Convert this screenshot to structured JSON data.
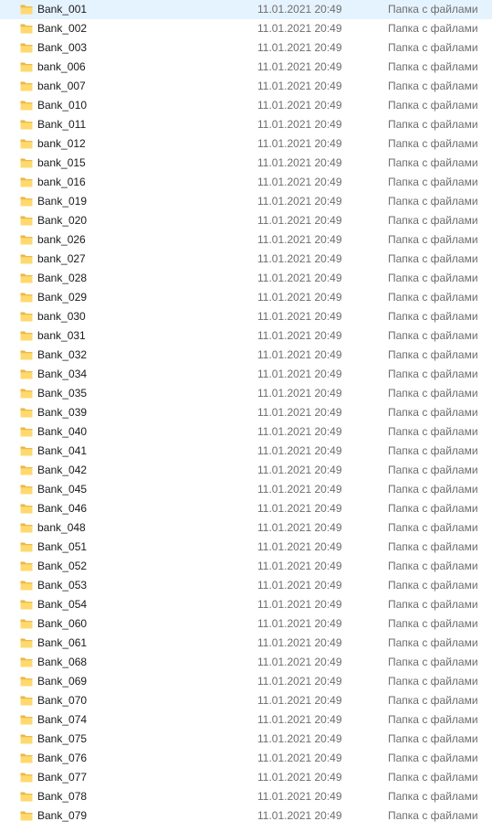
{
  "file_list": {
    "icon": "folder-icon",
    "items": [
      {
        "name": "Bank_001",
        "date": "11.01.2021 20:49",
        "type": "Папка с файлами"
      },
      {
        "name": "Bank_002",
        "date": "11.01.2021 20:49",
        "type": "Папка с файлами"
      },
      {
        "name": "Bank_003",
        "date": "11.01.2021 20:49",
        "type": "Папка с файлами"
      },
      {
        "name": "bank_006",
        "date": "11.01.2021 20:49",
        "type": "Папка с файлами"
      },
      {
        "name": "bank_007",
        "date": "11.01.2021 20:49",
        "type": "Папка с файлами"
      },
      {
        "name": "Bank_010",
        "date": "11.01.2021 20:49",
        "type": "Папка с файлами"
      },
      {
        "name": "Bank_011",
        "date": "11.01.2021 20:49",
        "type": "Папка с файлами"
      },
      {
        "name": "bank_012",
        "date": "11.01.2021 20:49",
        "type": "Папка с файлами"
      },
      {
        "name": "bank_015",
        "date": "11.01.2021 20:49",
        "type": "Папка с файлами"
      },
      {
        "name": "bank_016",
        "date": "11.01.2021 20:49",
        "type": "Папка с файлами"
      },
      {
        "name": "Bank_019",
        "date": "11.01.2021 20:49",
        "type": "Папка с файлами"
      },
      {
        "name": "Bank_020",
        "date": "11.01.2021 20:49",
        "type": "Папка с файлами"
      },
      {
        "name": "bank_026",
        "date": "11.01.2021 20:49",
        "type": "Папка с файлами"
      },
      {
        "name": "bank_027",
        "date": "11.01.2021 20:49",
        "type": "Папка с файлами"
      },
      {
        "name": "Bank_028",
        "date": "11.01.2021 20:49",
        "type": "Папка с файлами"
      },
      {
        "name": "Bank_029",
        "date": "11.01.2021 20:49",
        "type": "Папка с файлами"
      },
      {
        "name": "bank_030",
        "date": "11.01.2021 20:49",
        "type": "Папка с файлами"
      },
      {
        "name": "bank_031",
        "date": "11.01.2021 20:49",
        "type": "Папка с файлами"
      },
      {
        "name": "Bank_032",
        "date": "11.01.2021 20:49",
        "type": "Папка с файлами"
      },
      {
        "name": "Bank_034",
        "date": "11.01.2021 20:49",
        "type": "Папка с файлами"
      },
      {
        "name": "Bank_035",
        "date": "11.01.2021 20:49",
        "type": "Папка с файлами"
      },
      {
        "name": "Bank_039",
        "date": "11.01.2021 20:49",
        "type": "Папка с файлами"
      },
      {
        "name": "Bank_040",
        "date": "11.01.2021 20:49",
        "type": "Папка с файлами"
      },
      {
        "name": "Bank_041",
        "date": "11.01.2021 20:49",
        "type": "Папка с файлами"
      },
      {
        "name": "Bank_042",
        "date": "11.01.2021 20:49",
        "type": "Папка с файлами"
      },
      {
        "name": "Bank_045",
        "date": "11.01.2021 20:49",
        "type": "Папка с файлами"
      },
      {
        "name": "Bank_046",
        "date": "11.01.2021 20:49",
        "type": "Папка с файлами"
      },
      {
        "name": "bank_048",
        "date": "11.01.2021 20:49",
        "type": "Папка с файлами"
      },
      {
        "name": "Bank_051",
        "date": "11.01.2021 20:49",
        "type": "Папка с файлами"
      },
      {
        "name": "Bank_052",
        "date": "11.01.2021 20:49",
        "type": "Папка с файлами"
      },
      {
        "name": "Bank_053",
        "date": "11.01.2021 20:49",
        "type": "Папка с файлами"
      },
      {
        "name": "Bank_054",
        "date": "11.01.2021 20:49",
        "type": "Папка с файлами"
      },
      {
        "name": "Bank_060",
        "date": "11.01.2021 20:49",
        "type": "Папка с файлами"
      },
      {
        "name": "Bank_061",
        "date": "11.01.2021 20:49",
        "type": "Папка с файлами"
      },
      {
        "name": "Bank_068",
        "date": "11.01.2021 20:49",
        "type": "Папка с файлами"
      },
      {
        "name": "Bank_069",
        "date": "11.01.2021 20:49",
        "type": "Папка с файлами"
      },
      {
        "name": "Bank_070",
        "date": "11.01.2021 20:49",
        "type": "Папка с файлами"
      },
      {
        "name": "Bank_074",
        "date": "11.01.2021 20:49",
        "type": "Папка с файлами"
      },
      {
        "name": "Bank_075",
        "date": "11.01.2021 20:49",
        "type": "Папка с файлами"
      },
      {
        "name": "Bank_076",
        "date": "11.01.2021 20:49",
        "type": "Папка с файлами"
      },
      {
        "name": "Bank_077",
        "date": "11.01.2021 20:49",
        "type": "Папка с файлами"
      },
      {
        "name": "Bank_078",
        "date": "11.01.2021 20:49",
        "type": "Папка с файлами"
      },
      {
        "name": "Bank_079",
        "date": "11.01.2021 20:49",
        "type": "Папка с файлами"
      }
    ]
  }
}
